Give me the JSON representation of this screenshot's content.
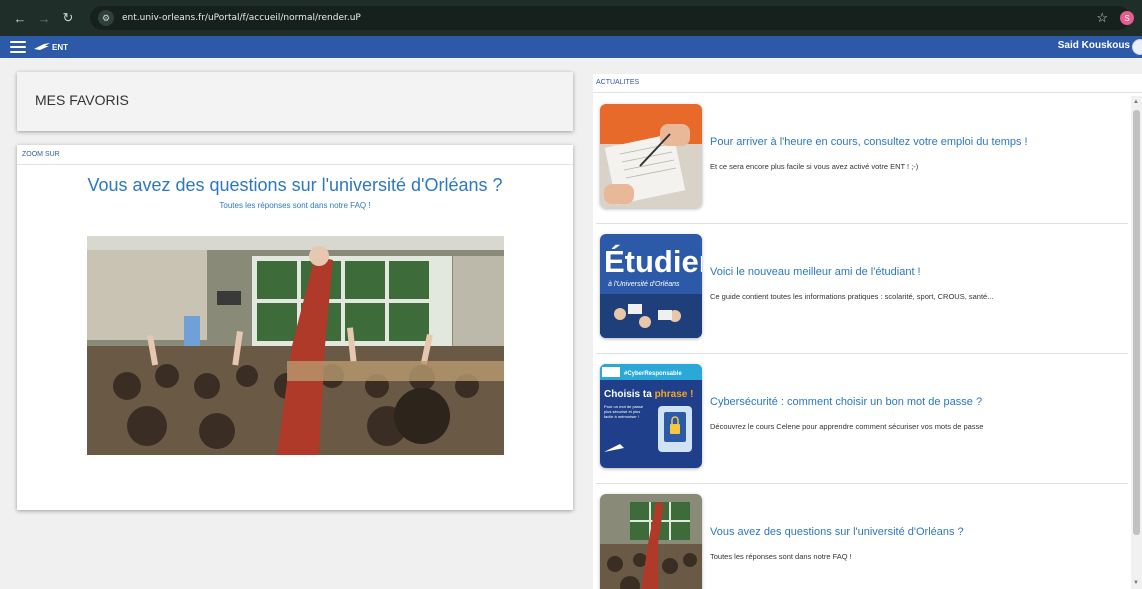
{
  "browser": {
    "url": "ent.univ-orleans.fr/uPortal/f/accueil/normal/render.uP",
    "profile_initial": "S"
  },
  "header": {
    "logo_text": "ENT",
    "user_name": "Said Kouskous"
  },
  "favoris": {
    "title": "MES FAVORIS"
  },
  "zoom": {
    "label": "ZOOM SUR",
    "headline": "Vous avez des questions sur l'université d'Orléans ?",
    "subtitle": "Toutes les réponses sont dans notre FAQ !"
  },
  "news": {
    "label": "ACTUALITES",
    "items": [
      {
        "title": "Pour arriver à l'heure en cours, consultez votre emploi du temps !",
        "description": "Et ce sera encore plus facile si vous avez activé votre ENT ! ;-)"
      },
      {
        "title": "Voici le nouveau meilleur ami de l'étudiant !",
        "description": "Ce guide contient toutes les informations pratiques : scolarité, sport, CROUS, santé...",
        "thumb_text": "Étudier",
        "thumb_subtext": "à l'Université d'Orléans"
      },
      {
        "title": "Cybersécurité : comment choisir un bon mot de passe ?",
        "description": "Découvrez le cours Celene pour apprendre comment sécuriser vos mots de passe",
        "thumb_tag": "#CyberResponsable",
        "thumb_title_1": "Choisis ta",
        "thumb_title_2": "phrase !",
        "thumb_body": "Pour un mot de passe plus sécurisé et plus facile à mémoriser !"
      },
      {
        "title": "Vous avez des questions sur l'université d'Orléans ?",
        "description": "Toutes les réponses sont dans notre FAQ !"
      }
    ]
  },
  "colors": {
    "brand_blue": "#2d5aa8",
    "link_blue": "#2c78c2"
  }
}
